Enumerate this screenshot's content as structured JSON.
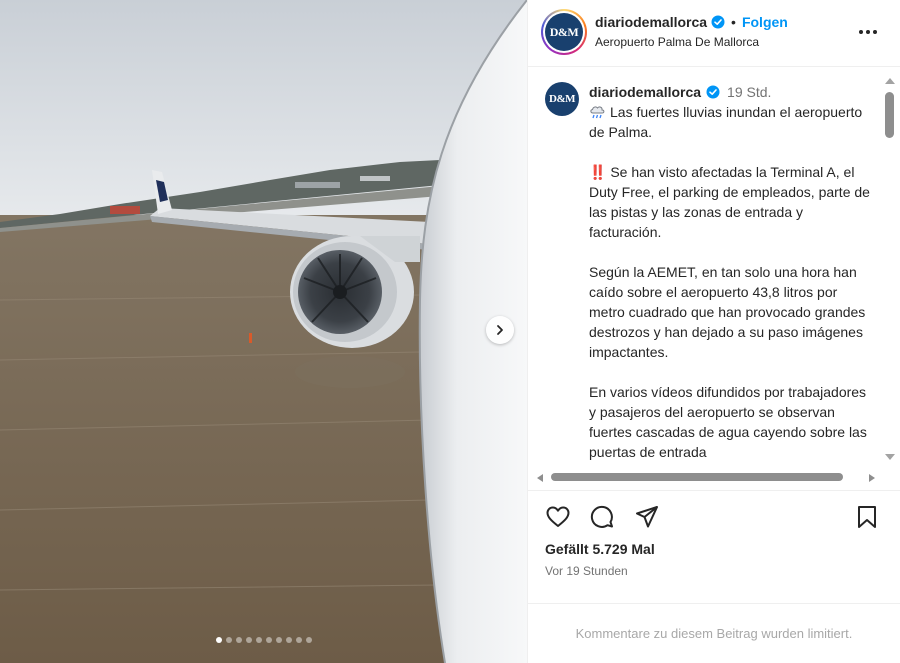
{
  "post": {
    "username": "diariodemallorca",
    "avatar_text": "D&M",
    "separator": "•",
    "follow_label": "Folgen",
    "location": "Aeropuerto Palma De Mallorca",
    "more_icon": "more-horizontal-icon",
    "verified_color": "#0095f6"
  },
  "caption": {
    "username": "diariodemallorca",
    "time": "19 Std.",
    "emoji_icon": "cloud-rain-icon",
    "paragraphs": [
      "Las fuertes lluvias inundan el aeropuerto de Palma.",
      "‼️ Se han visto afectadas la Terminal A, el Duty Free, el parking de empleados, parte de las pistas y las zonas de entrada y facturación.",
      "Según la AEMET, en tan solo una hora han caído sobre el aeropuerto 43,8 litros por metro cuadrado que han provocado grandes destrozos y han dejado a su paso imágenes impactantes.",
      "En varios vídeos difundidos por trabajadores y pasajeros del aeropuerto se observan fuertes cascadas de agua cayendo sobre las puertas de entrada"
    ]
  },
  "actions": {
    "like_icon": "heart-icon",
    "comment_icon": "comment-icon",
    "share_icon": "send-icon",
    "save_icon": "bookmark-icon",
    "likes_text": "Gefällt 5.729 Mal",
    "posted_text": "Vor 19 Stunden"
  },
  "comments": {
    "limited_text": "Kommentare zu diesem Beitrag wurden limitiert."
  },
  "carousel": {
    "total_slides": 10,
    "active_slide": 1,
    "next_icon": "chevron-right-icon"
  }
}
